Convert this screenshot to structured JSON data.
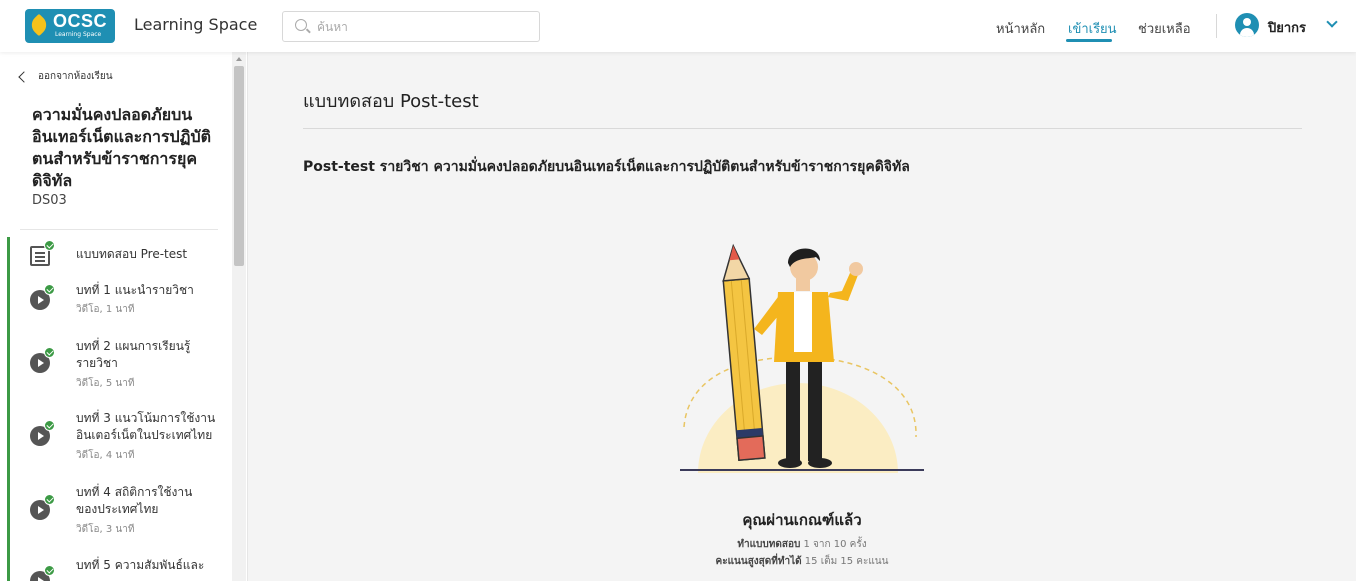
{
  "header": {
    "logo_text": "OCSC",
    "logo_sub": "Learning Space",
    "app_name": "Learning Space",
    "search_placeholder": "ค้นหา",
    "nav": [
      "หน้าหลัก",
      "เข้าเรียน",
      "ช่วยเหลือ"
    ],
    "active_nav": "เข้าเรียน",
    "user_name": "ปิยากร",
    "accent_color": "#1f8fb3"
  },
  "sidebar": {
    "back_label": "ออกจากห้องเรียน",
    "course_title": "ความมั่นคงปลอดภัยบนอินเทอร์เน็ตและการปฏิบัติตนสำหรับข้าราชการยุคดิจิทัล",
    "course_code": "DS03",
    "lessons": [
      {
        "label": "แบบทดสอบ Pre-test",
        "meta": "",
        "icon": "document-icon",
        "done": true
      },
      {
        "label": "บทที่ 1 แนะนำรายวิชา",
        "meta": "วิดีโอ, 1 นาที",
        "icon": "play-icon",
        "done": true
      },
      {
        "label": "บทที่ 2 แผนการเรียนรู้รายวิชา",
        "meta": "วิดีโอ, 5 นาที",
        "icon": "play-icon",
        "done": true
      },
      {
        "label": "บทที่ 3 แนวโน้มการใช้งานอินเตอร์เน็ตในประเทศไทย",
        "meta": "วิดีโอ, 4 นาที",
        "icon": "play-icon",
        "done": true
      },
      {
        "label": "บทที่ 4 สถิติการใช้งานของประเทศไทย",
        "meta": "วิดีโอ, 3 นาที",
        "icon": "play-icon",
        "done": true
      },
      {
        "label": "บทที่ 5 ความสัมพันธ์และ",
        "meta": "",
        "icon": "play-icon",
        "done": true
      }
    ],
    "progress_color": "#3c9a45"
  },
  "main": {
    "page_title": "แบบทดสอบ Post-test",
    "subject": "Post-test รายวิชา ความมั่นคงปลอดภัยบนอินเทอร์เน็ตและการปฏิบัติตนสำหรับข้าราชการยุคดิจิทัล",
    "result_title": "คุณผ่านเกณฑ์แล้ว",
    "attempt_label": "ทำแบบทดสอบ",
    "attempt_value": "1 จาก 10 ครั้ง",
    "score_label": "คะแนนสูงสุดที่ทำได้",
    "score_value": "15 เต็ม 15 คะแนน"
  }
}
